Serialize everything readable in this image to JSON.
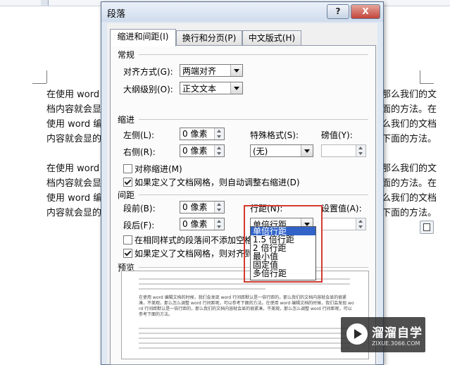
{
  "document": {
    "para1": [
      "在使用 word",
      "档内容就会显",
      "使用 word 编",
      "内容就会显的"
    ],
    "para1_right": [
      "那么我们的文",
      "面的方法。在",
      "么我们的文档",
      "下面的方法。"
    ],
    "para2": [
      "在使用 word",
      "档内容就会显",
      "使用 word 编",
      "内容就会显的"
    ],
    "para2_right": [
      "那么我们的文",
      "面的方法。在",
      "么我们的文档",
      "下面的方法。"
    ]
  },
  "dialog": {
    "title": "段落",
    "help": "?",
    "close": "X",
    "tabs": [
      "缩进和间距(I)",
      "换行和分页(P)",
      "中文版式(H)"
    ],
    "general": {
      "heading": "常规",
      "alignment_label": "对齐方式(G):",
      "alignment_value": "两端对齐",
      "outline_label": "大纲级别(O):",
      "outline_value": "正文文本"
    },
    "indent": {
      "heading": "缩进",
      "left_label": "左侧(L):",
      "left_value": "0 像素",
      "right_label": "右侧(R):",
      "right_value": "0 像素",
      "special_label": "特殊格式(S):",
      "special_value": "(无)",
      "by_label": "磅值(Y):",
      "mirror_label": "对称缩进(M)",
      "auto_adjust_label": "如果定义了文档网格，则自动调整右缩进(D)"
    },
    "spacing": {
      "heading": "间距",
      "before_label": "段前(B):",
      "before_value": "0 像素",
      "after_label": "段后(F):",
      "after_value": "0 像素",
      "line_label": "行距(N):",
      "line_value": "单倍行距",
      "at_label": "设置值(A):",
      "no_space_label": "在相同样式的段落间不添加空格",
      "snap_grid_label": "如果定义了文档网格，则对齐到",
      "line_options": [
        "单倍行距",
        "1.5 倍行距",
        "2 倍行距",
        "最小值",
        "固定值",
        "多倍行距"
      ]
    },
    "preview": {
      "heading": "预览",
      "sample_text": "在使用 word 编辑文档的时候，我们会发现 word 行间距默认是一倍行距的，那么我们的文档内容就会显的很紧凑，不美观，那么怎么调整 word 行间距呢，可以参考下面的方法。在使用 word 编辑文档的时候，我们会发现 word 行间距默认是一倍行距的，那么我们的文档内容就会显的很紧凑，不美观，那么怎么调整 word 行间距呢，可以参考下面的方法。"
    }
  },
  "watermark": {
    "title": "溜溜自学",
    "url": "ZIXUE.3066.COM"
  }
}
